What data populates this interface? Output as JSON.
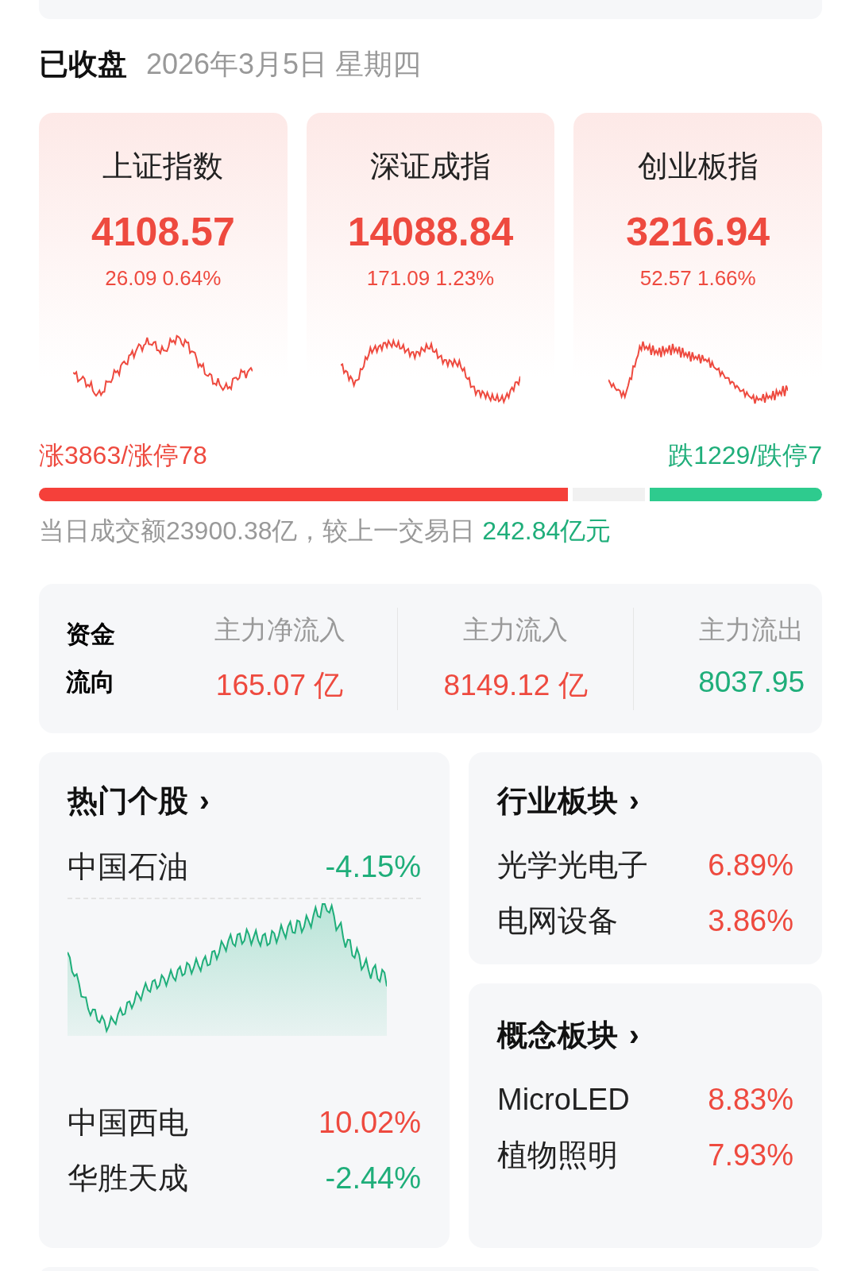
{
  "header": {
    "status": "已收盘",
    "date": "2026年3月5日 星期四"
  },
  "indices": [
    {
      "name": "上证指数",
      "value": "4108.57",
      "change": "26.09 0.64%"
    },
    {
      "name": "深证成指",
      "value": "14088.84",
      "change": "171.09 1.23%"
    },
    {
      "name": "创业板指",
      "value": "3216.94",
      "change": "52.57 1.66%"
    }
  ],
  "breadth": {
    "up_text": "涨3863/涨停78",
    "down_text": "跌1229/跌停7",
    "up_bar": {
      "level": 0.675
    },
    "down_bar": {
      "level": 0.22
    }
  },
  "turnover": {
    "text": "当日成交额23900.38亿，较上一交易日",
    "diff": "242.84亿元"
  },
  "fund_flow": {
    "title": "资金流向",
    "items": [
      {
        "label": "主力净流入",
        "value": "165.07 亿",
        "color": "#ee4a3f"
      },
      {
        "label": "主力流入",
        "value": "8149.12 亿",
        "color": "#ee4a3f"
      },
      {
        "label": "主力流出",
        "value": "8037.95",
        "color": "#1fae7a"
      }
    ]
  },
  "hot_stocks": {
    "title": "热门个股",
    "arrow": "›",
    "featured": {
      "name": "中国石油",
      "change": "-4.15%",
      "color": "#1fae7a"
    },
    "rows": [
      {
        "name": "中国西电",
        "change": "10.02%",
        "color": "#ee4a3f"
      },
      {
        "name": "华胜天成",
        "change": "-2.44%",
        "color": "#1fae7a"
      }
    ]
  },
  "industry": {
    "title": "行业板块",
    "arrow": "›",
    "rows": [
      {
        "name": "光学光电子",
        "change": "6.89%",
        "color": "#ee4a3f"
      },
      {
        "name": "电网设备",
        "change": "3.86%",
        "color": "#ee4a3f"
      }
    ]
  },
  "concept": {
    "title": "概念板块",
    "arrow": "›",
    "rows": [
      {
        "name": "MicroLED",
        "change": "8.83%",
        "color": "#ee4a3f"
      },
      {
        "name": "植物照明",
        "change": "7.93%",
        "color": "#ee4a3f"
      }
    ]
  }
}
